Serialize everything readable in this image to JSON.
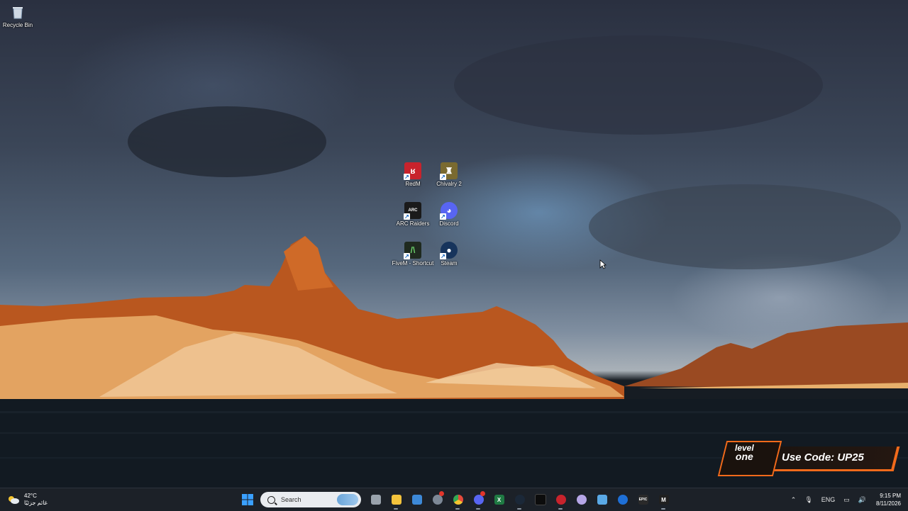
{
  "desktop": {
    "recycle_bin": "Recycle Bin",
    "icons": [
      {
        "label": "RedM",
        "color": "#c8232c",
        "glyph": "ʁ"
      },
      {
        "label": "Chivalry 2",
        "color": "#7a6a30",
        "glyph": "♜"
      },
      {
        "label": "ARC Raiders",
        "color": "#1a1a1a",
        "glyph": "ARC"
      },
      {
        "label": "Discord",
        "color": "#5865f2",
        "glyph": "◕"
      },
      {
        "label": "FiveM - Shortcut",
        "color": "#1f2a1f",
        "glyph": "/\\"
      },
      {
        "label": "Steam",
        "color": "#17345c",
        "glyph": "●"
      }
    ]
  },
  "promo": {
    "brand_line1": "level",
    "brand_line2": "one",
    "code_text": "Use Code: UP25",
    "accent": "#f26a1b"
  },
  "taskbar": {
    "weather_temp": "42°C",
    "weather_desc": "غائم جزئيًا",
    "search_placeholder": "Search",
    "apps": [
      {
        "name": "start-button",
        "icon": "windows-logo",
        "color": "#3aa0ff",
        "glyph": "⊞"
      },
      {
        "name": "task-view-button",
        "icon": "task-view",
        "color": "#9aa3ad",
        "glyph": "▣"
      },
      {
        "name": "file-explorer-button",
        "icon": "folder",
        "color": "#f3c33c",
        "glyph": "▬"
      },
      {
        "name": "microsoft-store-button",
        "icon": "store",
        "color": "#3d89d8",
        "glyph": "▦"
      },
      {
        "name": "copilot-button",
        "icon": "copilot",
        "color": "#7d8896",
        "glyph": "✿"
      },
      {
        "name": "chrome-button",
        "icon": "chrome",
        "color": "#e64a3b",
        "glyph": "◉"
      },
      {
        "name": "discord-taskbar-button",
        "icon": "discord",
        "color": "#5865f2",
        "glyph": "◕"
      },
      {
        "name": "excel-button",
        "icon": "excel",
        "color": "#1f7a43",
        "glyph": "X"
      },
      {
        "name": "steam-taskbar-button",
        "icon": "steam",
        "color": "#1b2838",
        "glyph": "●"
      },
      {
        "name": "terminal-button",
        "icon": "terminal",
        "color": "#0c0c0c",
        "glyph": "_"
      },
      {
        "name": "redm-taskbar-button",
        "icon": "redm",
        "color": "#c8232c",
        "glyph": "ʁ"
      },
      {
        "name": "app-circle-button",
        "icon": "circle-app",
        "color": "#b6a6e6",
        "glyph": "◎"
      },
      {
        "name": "window-app-button",
        "icon": "window-app",
        "color": "#5aa9e6",
        "glyph": "▭"
      },
      {
        "name": "battlenet-button",
        "icon": "battlenet",
        "color": "#1e6fd6",
        "glyph": "✧"
      },
      {
        "name": "epic-games-button",
        "icon": "epic",
        "color": "#2a2a2a",
        "glyph": "EPIC"
      },
      {
        "name": "unknown-app-button",
        "icon": "m-app",
        "color": "#202020",
        "glyph": "M"
      }
    ],
    "tray": {
      "language": "ENG",
      "time": "9:15 PM",
      "date": "8/11/2026"
    }
  }
}
